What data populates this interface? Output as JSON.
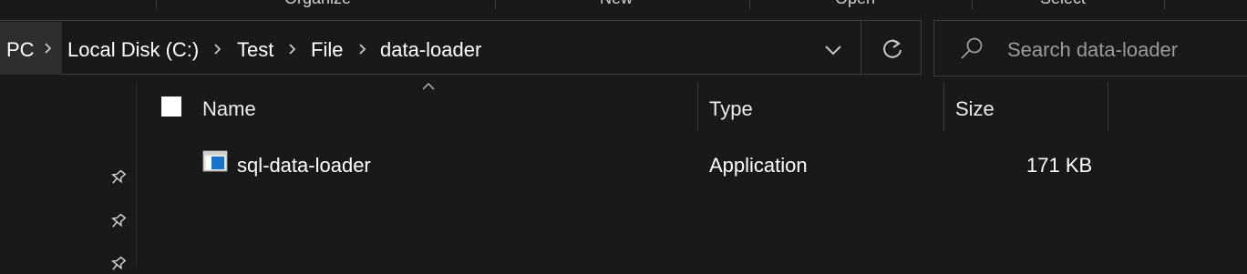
{
  "ribbon": {
    "groups": [
      "Organize",
      "New",
      "Open",
      "Select"
    ]
  },
  "address": {
    "root": "PC",
    "crumbs": [
      "Local Disk (C:)",
      "Test",
      "File",
      "data-loader"
    ]
  },
  "search": {
    "placeholder": "Search data-loader"
  },
  "columns": {
    "name": "Name",
    "type": "Type",
    "size": "Size"
  },
  "files": [
    {
      "name": "sql-data-loader",
      "type": "Application",
      "size": "171 KB"
    }
  ],
  "colors": {
    "background": "#191919",
    "text": "#ffffff",
    "border": "#3c3c3c",
    "app_icon_blue": "#1a73c8"
  },
  "icons": [
    "chevron-right-icon",
    "chevron-down-icon",
    "refresh-icon",
    "search-icon",
    "pin-icon",
    "application-icon",
    "sort-up-icon"
  ]
}
